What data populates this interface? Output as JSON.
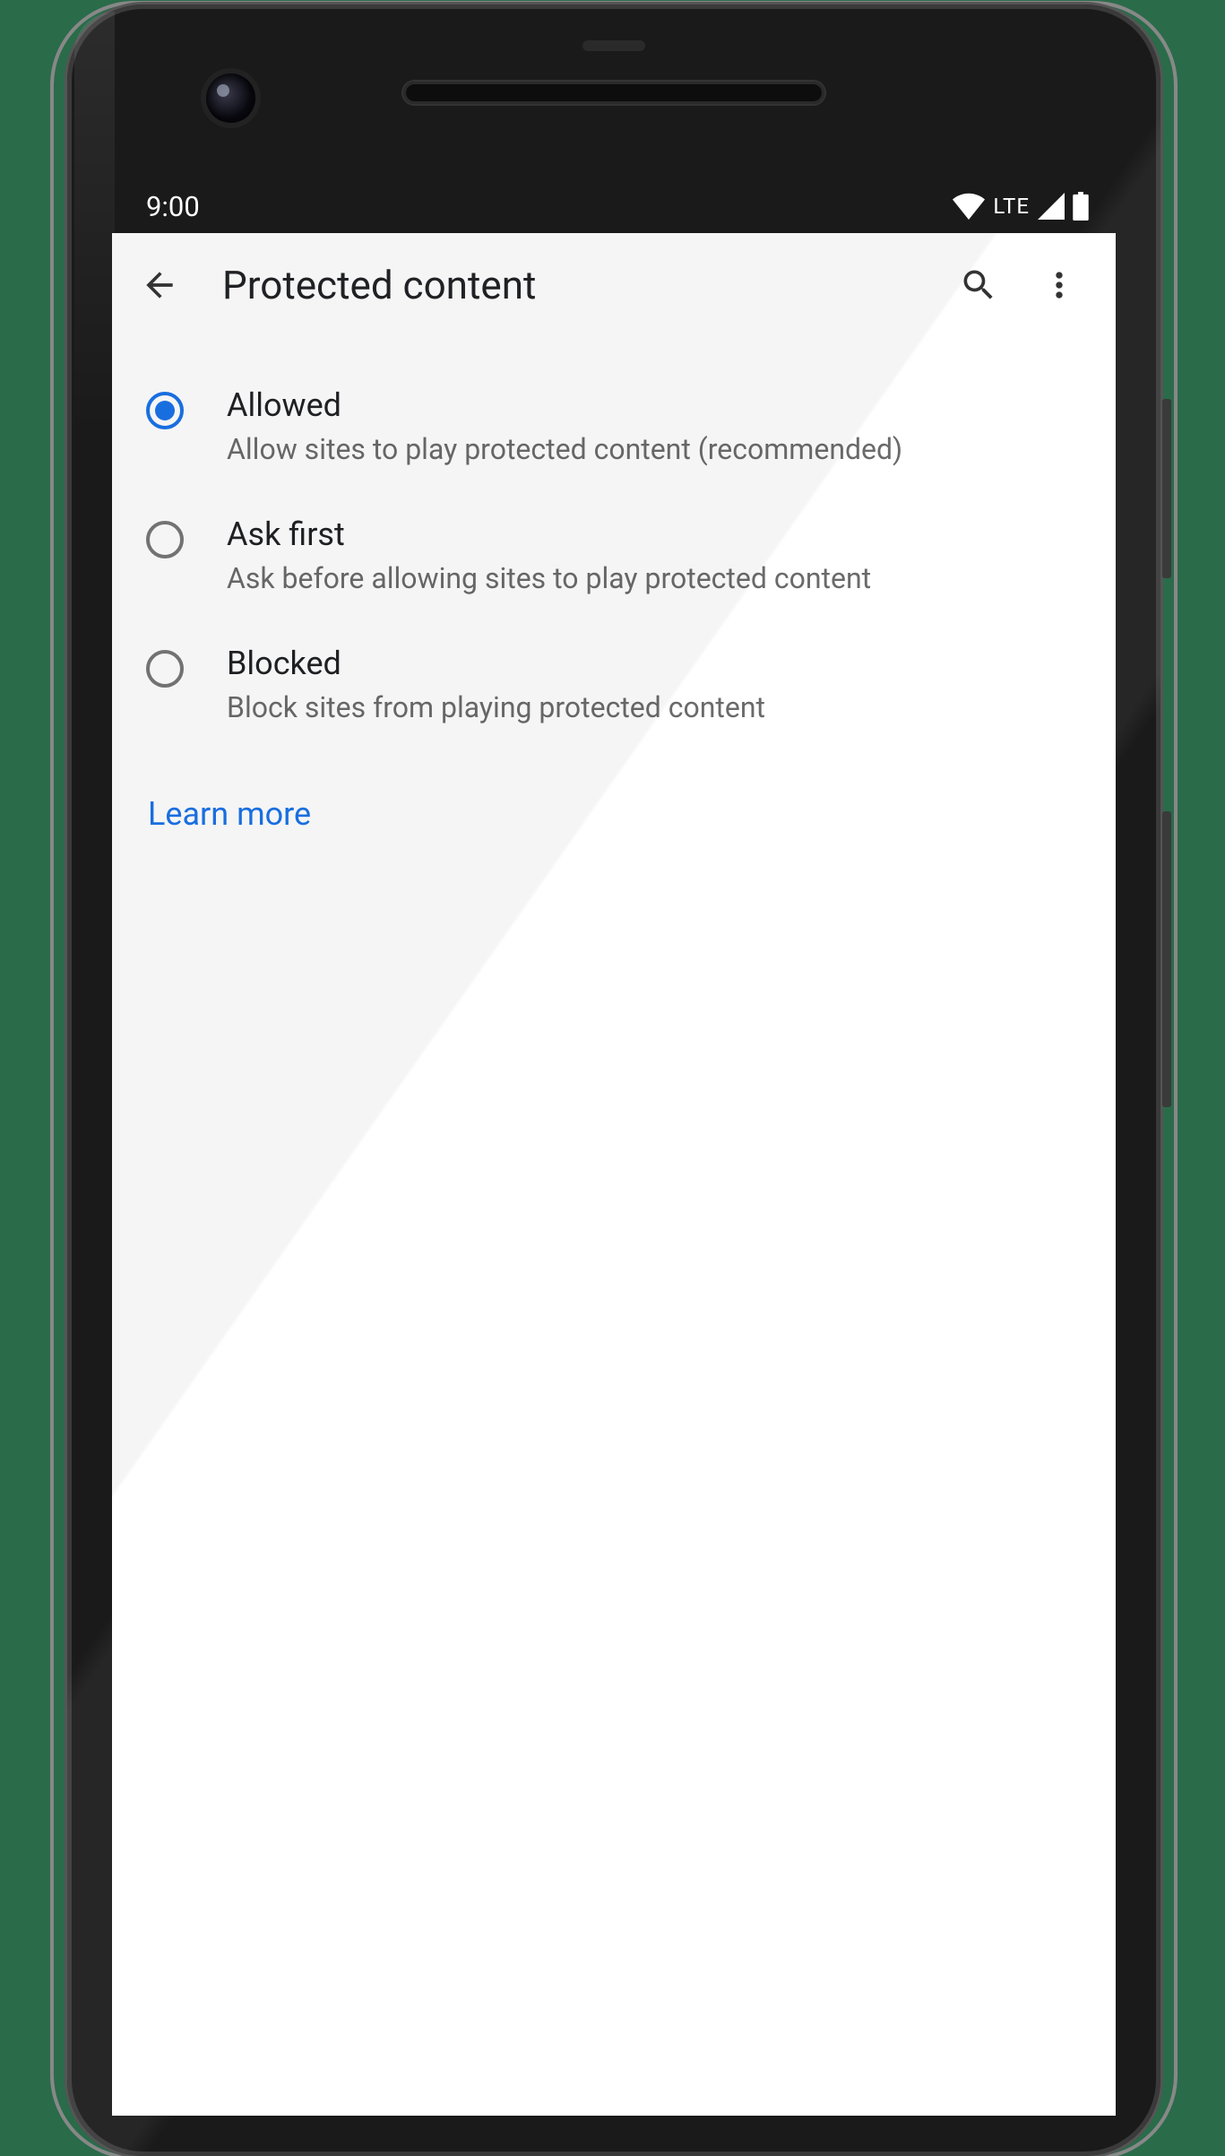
{
  "status_bar": {
    "time": "9:00",
    "network_label": "LTE"
  },
  "app_bar": {
    "title": "Protected content"
  },
  "options": [
    {
      "title": "Allowed",
      "description": "Allow sites to play protected content (recommended)",
      "selected": true
    },
    {
      "title": "Ask first",
      "description": "Ask before allowing sites to play protected content",
      "selected": false
    },
    {
      "title": "Blocked",
      "description": "Block sites from playing protected content",
      "selected": false
    }
  ],
  "learn_more": "Learn more"
}
